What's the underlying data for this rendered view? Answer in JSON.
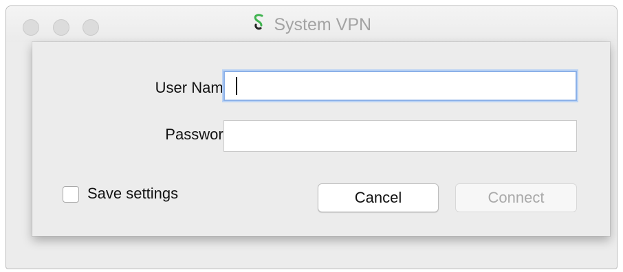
{
  "window": {
    "title": "System VPN",
    "icon": "vpn-s-logo-icon"
  },
  "form": {
    "username_label": "User Name:",
    "username_value": "",
    "password_label": "Password:",
    "password_value": ""
  },
  "options": {
    "save_settings_label": "Save settings",
    "save_settings_checked": false
  },
  "buttons": {
    "cancel_label": "Cancel",
    "connect_label": "Connect",
    "connect_enabled": false
  },
  "colors": {
    "focus_ring": "#8cb1e8",
    "disabled_text": "#a9a9a9",
    "logo_green": "#3fb34f"
  }
}
